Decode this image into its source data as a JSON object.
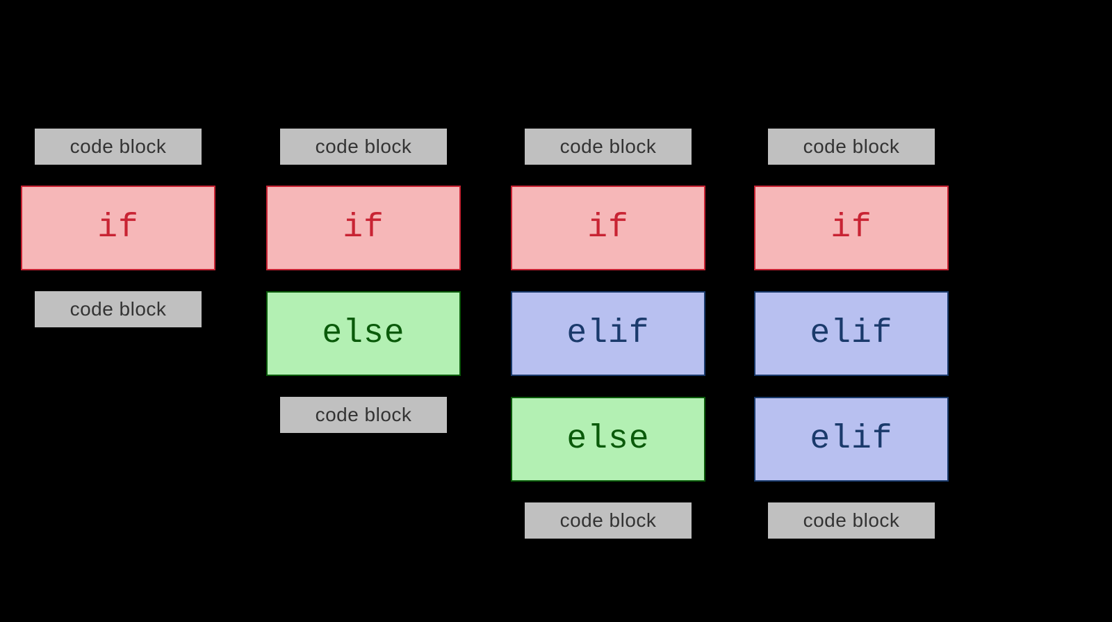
{
  "labels": {
    "code_block": "code block",
    "if": "if",
    "else": "else",
    "elif": "elif"
  },
  "columns": [
    {
      "items": [
        {
          "type": "code"
        },
        {
          "type": "if"
        },
        {
          "type": "code"
        }
      ]
    },
    {
      "items": [
        {
          "type": "code"
        },
        {
          "type": "if"
        },
        {
          "type": "else"
        },
        {
          "type": "code"
        }
      ]
    },
    {
      "items": [
        {
          "type": "code"
        },
        {
          "type": "if"
        },
        {
          "type": "elif"
        },
        {
          "type": "else"
        },
        {
          "type": "code"
        }
      ]
    },
    {
      "items": [
        {
          "type": "code"
        },
        {
          "type": "if"
        },
        {
          "type": "elif"
        },
        {
          "type": "elif"
        },
        {
          "type": "code"
        }
      ]
    }
  ]
}
